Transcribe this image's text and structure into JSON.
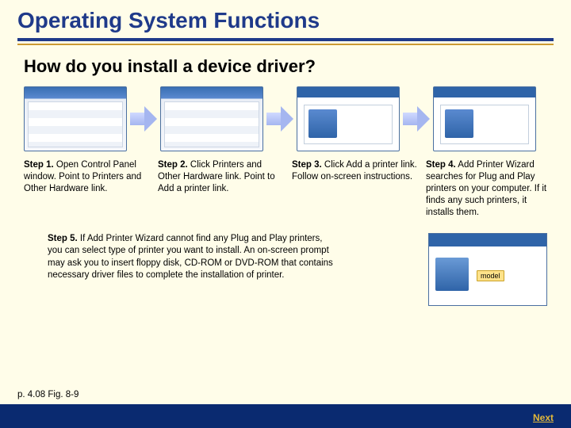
{
  "title": "Operating System Functions",
  "subtitle": "How do you install a device driver?",
  "steps": {
    "s1": {
      "label": "Step 1.",
      "text": " Open Control Panel window. Point to Printers and Other Hardware link."
    },
    "s2": {
      "label": "Step 2.",
      "text": " Click Printers and Other Hardware link. Point to Add a printer link."
    },
    "s3": {
      "label": "Step 3.",
      "text": " Click Add a printer link. Follow on-screen instructions."
    },
    "s4": {
      "label": "Step 4.",
      "text": " Add Printer Wizard searches for Plug and Play printers on your computer. If it finds any such printers, it installs them."
    },
    "s5": {
      "label": "Step 5.",
      "text": " If Add Printer Wizard cannot find any Plug and Play printers, you can select type of printer you want to install. An on-screen prompt may ask you to insert floppy disk, CD-ROM or DVD-ROM that contains necessary driver files to complete the installation of printer."
    }
  },
  "callout_model": "model",
  "page_ref": "p. 4.08 Fig. 8-9",
  "next_label": "Next"
}
